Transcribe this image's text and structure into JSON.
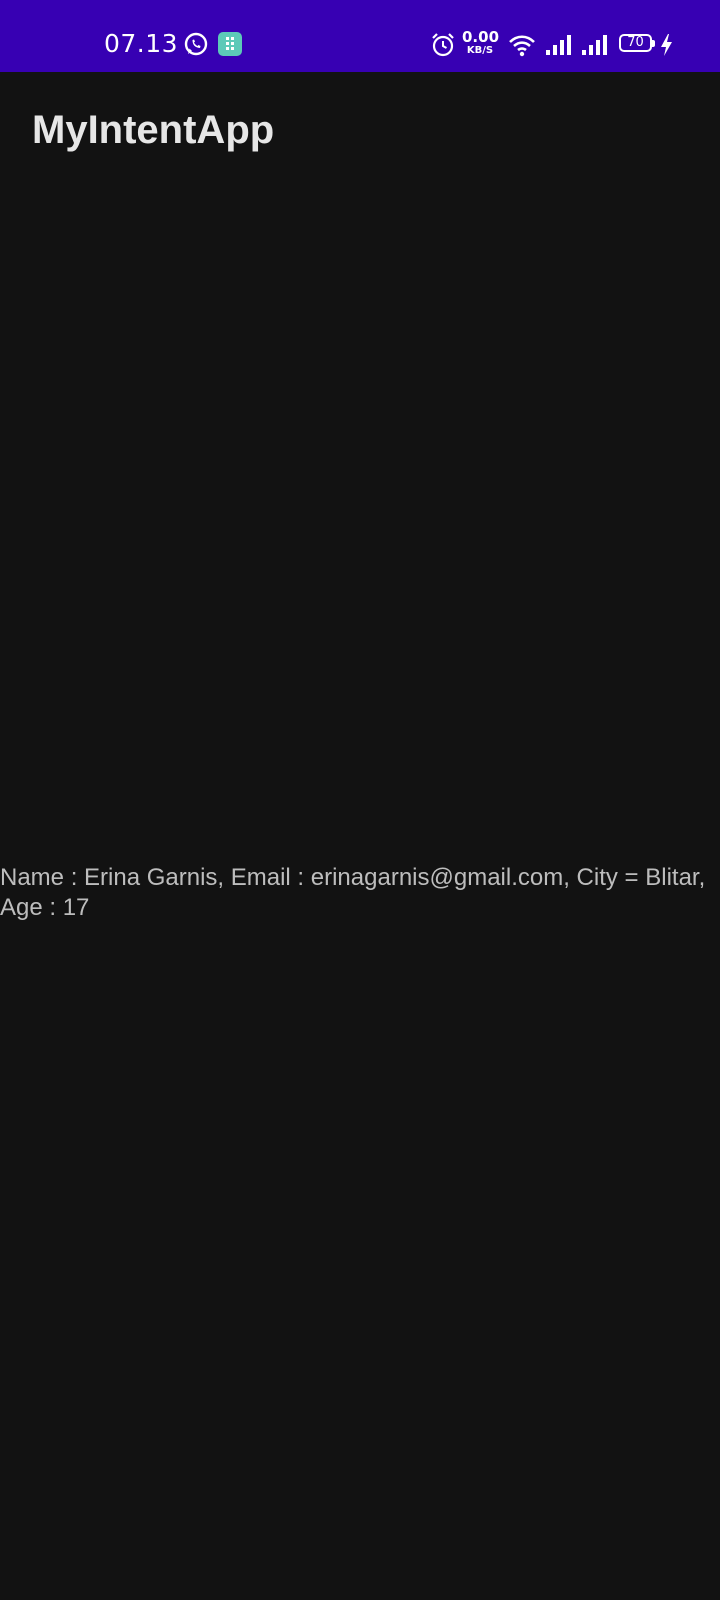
{
  "status_bar": {
    "time": "07.13",
    "network_speed_value": "0.00",
    "network_speed_unit": "KB/S",
    "battery_level": "70",
    "background_color": "#3700b3",
    "icons": [
      "whatsapp-icon",
      "app-notification-icon",
      "alarm-icon",
      "wifi-icon",
      "signal-icon",
      "signal-icon",
      "battery-icon",
      "charging-icon"
    ]
  },
  "app_bar": {
    "title": "MyIntentApp"
  },
  "main": {
    "received_data_text": "Name : Erina Garnis, Email : erinagarnis@gmail.com, City = Blitar, Age : 17"
  },
  "colors": {
    "background": "#121212",
    "title_text": "#e6e6e6",
    "body_text": "#bdbdbd",
    "notification_badge": "#5cc9b8"
  }
}
